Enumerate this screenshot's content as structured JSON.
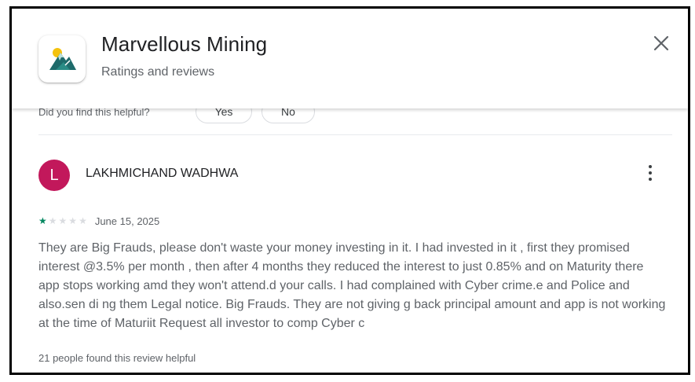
{
  "header": {
    "app_title": "Marvellous Mining",
    "subtitle": "Ratings and reviews",
    "close_icon": "close-icon"
  },
  "previous_review": {
    "helpful_question": "Did you find this helpful?",
    "yes_label": "Yes",
    "no_label": "No"
  },
  "review": {
    "avatar_letter": "L",
    "avatar_color": "#c2185b",
    "reviewer_name": "LAKHMICHAND WADHWA",
    "rating": 1,
    "max_rating": 5,
    "date": "June 15, 2025",
    "body": "They are Big Frauds, please don't waste your money investing in it. I had invested in it , first they promised interest @3.5% per month , then after 4 months they reduced the interest to just 0.85% and on Maturity there app stops working amd they won't attend.d your calls. I had complained with Cyber crime.e and Police and also.sen di ng them Legal notice. Big Frauds. They are not giving g back principal amount and app is not working at the time of Maturiit Request all investor to comp Cyber c",
    "helpful_count_text": "21 people found this review helpful",
    "more_icon": "more-vert-icon"
  },
  "colors": {
    "star_active": "#01875f",
    "star_inactive": "#dadce0",
    "secondary_text": "#5f6368"
  }
}
